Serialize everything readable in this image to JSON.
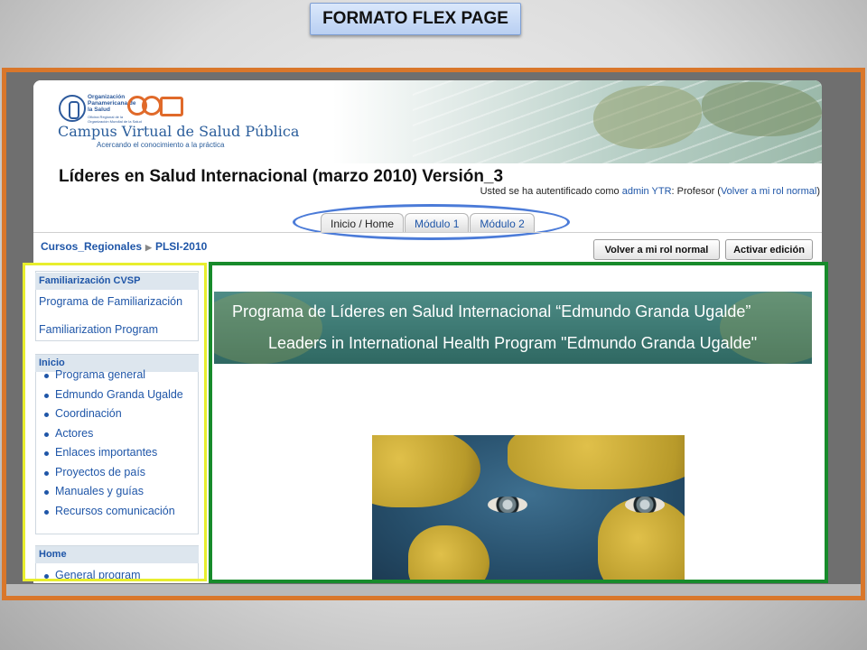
{
  "slide": {
    "title": "FORMATO FLEX PAGE"
  },
  "site": {
    "org_name": "Organización Panamericana de la Salud",
    "org_subtitle": "Oficina Regional de la Organización Mundial de la Salud",
    "campus_title": "Campus Virtual de Salud Pública",
    "campus_tagline": "Acercando el conocimiento a la práctica"
  },
  "course": {
    "title": "Líderes en Salud Internacional (marzo 2010) Versión_3",
    "login_prefix": "Usted se ha autentificado como ",
    "login_user": "admin YTR",
    "login_role": ": Profesor (",
    "login_return": "Volver a mi rol normal",
    "login_suffix": ")"
  },
  "tabs": [
    {
      "label": "Inicio / Home",
      "active": true
    },
    {
      "label": "Módulo 1",
      "active": false
    },
    {
      "label": "Módulo 2",
      "active": false
    }
  ],
  "breadcrumb": {
    "items": [
      "Cursos_Regionales",
      "PLSI-2010"
    ],
    "separator": "▶"
  },
  "buttons": {
    "return_role": "Volver a mi rol normal",
    "edit": "Activar edición"
  },
  "sidebar": {
    "familiarization": {
      "heading": "Familiarización CVSP",
      "links": [
        "Programa de Familiarización",
        "Familiarization Program"
      ]
    },
    "inicio": {
      "heading": "Inicio",
      "items": [
        "Programa general",
        "Edmundo Granda Ugalde",
        "Coordinación",
        "Actores",
        "Enlaces importantes",
        "Proyectos de país",
        "Manuales y guías",
        "Recursos comunicación"
      ]
    },
    "home": {
      "heading": "Home",
      "items": [
        "General program"
      ]
    }
  },
  "main": {
    "banner_line1": "Programa de Líderes en Salud Internacional “Edmundo Granda Ugalde”",
    "banner_line2": "Leaders in International Health Program \"Edmundo Granda Ugalde\""
  },
  "colors": {
    "frame_orange": "#d9772b",
    "sidebar_highlight": "#e8ee2d",
    "main_highlight": "#178b2b",
    "tab_oval": "#4b7bd8",
    "link_blue": "#1f56a8"
  }
}
